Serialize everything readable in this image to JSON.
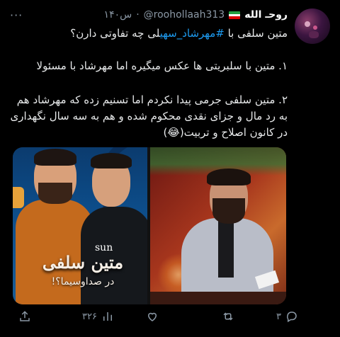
{
  "author": {
    "display_name": "روحـ الله",
    "handle": "@roohollaah313",
    "time": "۱۴۰س",
    "flag": "iran-flag-icon"
  },
  "tweet": {
    "line1_before": "متین سلفی با ",
    "hashtag": "#مهرشاد_سهی",
    "line1_after": "لی چه تفاوتی دارن؟",
    "point1": "۱. متین با سلبریتی ها عکس میگیره اما مهرشاد با مسئولا",
    "point2": "۲. متین سلفی جرمی پیدا نکردم اما تسنیم زده که مهرشاد هم به رد مال و جزای نقدی محکوم شده و  هم به سه سال نگهداری در کانون اصلاح و تربیت(😂)"
  },
  "media": {
    "left_title": "متین سلفی",
    "left_subtitle": "در صداوسیما؟!",
    "left_shirt_text": "sun"
  },
  "actions": {
    "views": "۳۲۶",
    "likes": "",
    "retweets": "",
    "replies": "۳"
  },
  "colors": {
    "background": "#000000",
    "text": "#e7e9ea",
    "muted": "#8b98a5",
    "link": "#1d9bf0"
  }
}
